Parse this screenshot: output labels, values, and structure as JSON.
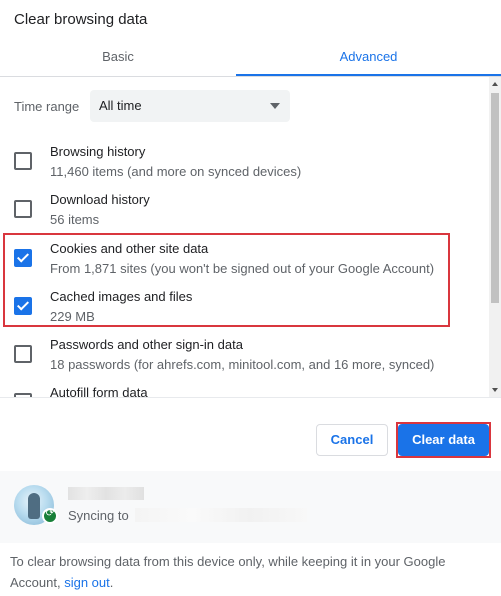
{
  "dialog": {
    "title": "Clear browsing data"
  },
  "tabs": [
    {
      "label": "Basic",
      "selected": false
    },
    {
      "label": "Advanced",
      "selected": true
    }
  ],
  "time_range": {
    "label": "Time range",
    "value": "All time"
  },
  "options": [
    {
      "title": "Browsing history",
      "subtitle": "11,460 items (and more on synced devices)",
      "checked": false
    },
    {
      "title": "Download history",
      "subtitle": "56 items",
      "checked": false
    },
    {
      "title": "Cookies and other site data",
      "subtitle": "From 1,871 sites (you won't be signed out of your Google Account)",
      "checked": true
    },
    {
      "title": "Cached images and files",
      "subtitle": "229 MB",
      "checked": true
    },
    {
      "title": "Passwords and other sign-in data",
      "subtitle": "18 passwords (for ahrefs.com, minitool.com, and 16 more, synced)",
      "checked": false
    },
    {
      "title": "Autofill form data",
      "subtitle": "",
      "checked": false
    }
  ],
  "buttons": {
    "cancel": "Cancel",
    "clear": "Clear data"
  },
  "sync": {
    "status": "Syncing to"
  },
  "info": {
    "text": "To clear browsing data from this device only, while keeping it in your Google Account, ",
    "link": "sign out",
    "after": "."
  },
  "colors": {
    "accent": "#1a73e8",
    "highlight": "#d9363e",
    "sync_badge": "#188038"
  }
}
